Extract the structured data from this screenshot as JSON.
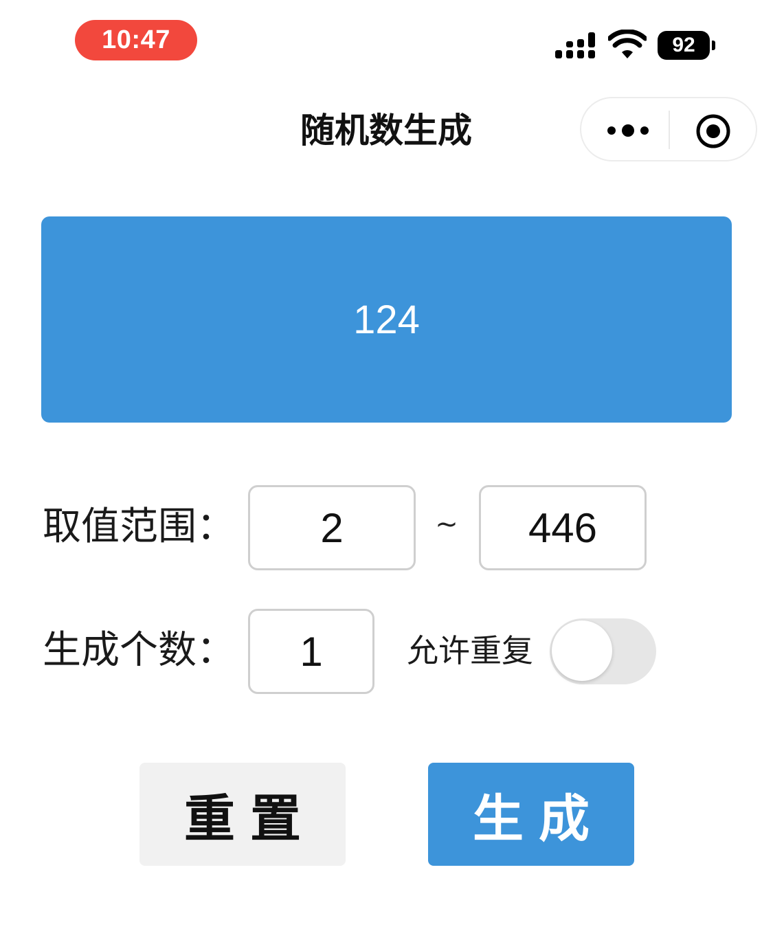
{
  "status_bar": {
    "time": "10:47",
    "battery": "92",
    "time_pill_color": "#f2483d",
    "icons": [
      "signal-icon",
      "wifi-icon",
      "battery-icon"
    ]
  },
  "nav": {
    "title": "随机数生成",
    "capsule_icons": [
      "more-dots-icon",
      "close-target-icon"
    ]
  },
  "result": {
    "value": "124",
    "color": "#3d94da"
  },
  "range": {
    "label": "取值范围：",
    "min": "2",
    "separator": "~",
    "max": "446"
  },
  "count": {
    "label": "生成个数：",
    "value": "1"
  },
  "allow_repeat": {
    "label": "允许重复",
    "enabled": false
  },
  "buttons": {
    "reset": "重置",
    "generate": "生成"
  },
  "colors": {
    "accent": "#3d94da",
    "secondary_button": "#f1f1f1"
  }
}
